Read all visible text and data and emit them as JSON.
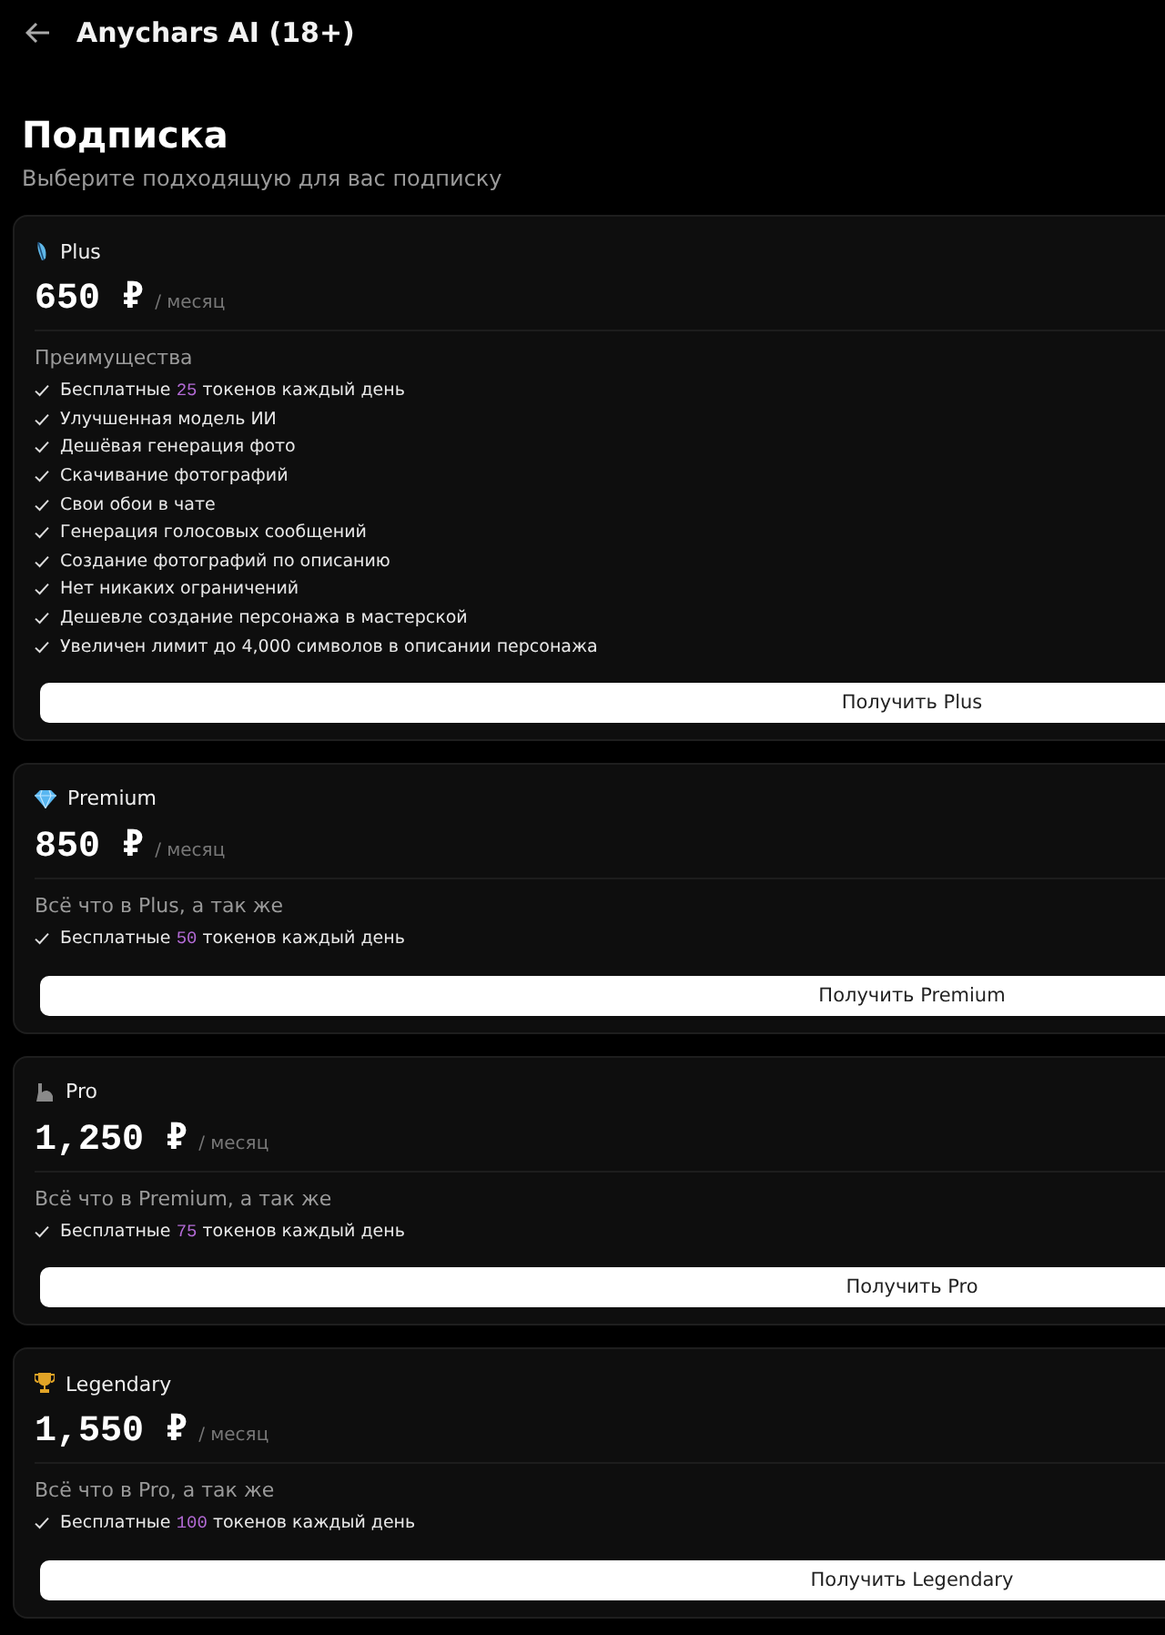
{
  "header": {
    "title": "Anychars AI (18+)"
  },
  "page": {
    "title": "Подписка",
    "subtitle": "Выберите подходящую для вас подписку"
  },
  "plans": [
    {
      "name": "Plus",
      "price": "650 ₽",
      "period": "/ месяц",
      "section_title": "Преимущества",
      "features": [
        {
          "before": "Бесплатные ",
          "highlight": "25",
          "after": " токенов каждый день"
        },
        {
          "before": "Улучшенная модель ИИ"
        },
        {
          "before": "Дешёвая генерация фото"
        },
        {
          "before": "Скачивание фотографий"
        },
        {
          "before": "Свои обои в чате"
        },
        {
          "before": "Генерация голосовых сообщений"
        },
        {
          "before": "Создание фотографий по описанию"
        },
        {
          "before": "Нет никаких ограничений"
        },
        {
          "before": "Дешевле создание персонажа в мастерской"
        },
        {
          "before": "Увеличен лимит до 4,000 символов в описании персонажа"
        }
      ],
      "button": "Получить Plus"
    },
    {
      "name": "Premium",
      "price": "850 ₽",
      "period": "/ месяц",
      "section_title": "Всё что в Plus, а так же",
      "features": [
        {
          "before": "Бесплатные ",
          "highlight": "50",
          "after": " токенов каждый день"
        }
      ],
      "button": "Получить Premium"
    },
    {
      "name": "Pro",
      "price": "1,250 ₽",
      "period": "/ месяц",
      "section_title": "Всё что в Premium, а так же",
      "features": [
        {
          "before": "Бесплатные ",
          "highlight": "75",
          "after": " токенов каждый день"
        }
      ],
      "button": "Получить Pro"
    },
    {
      "name": "Legendary",
      "price": "1,550 ₽",
      "period": "/ месяц",
      "section_title": "Всё что в Pro, а так же",
      "features": [
        {
          "before": "Бесплатные ",
          "highlight": "100",
          "after": " токенов каждый день"
        }
      ],
      "button": "Получить Legendary"
    }
  ]
}
